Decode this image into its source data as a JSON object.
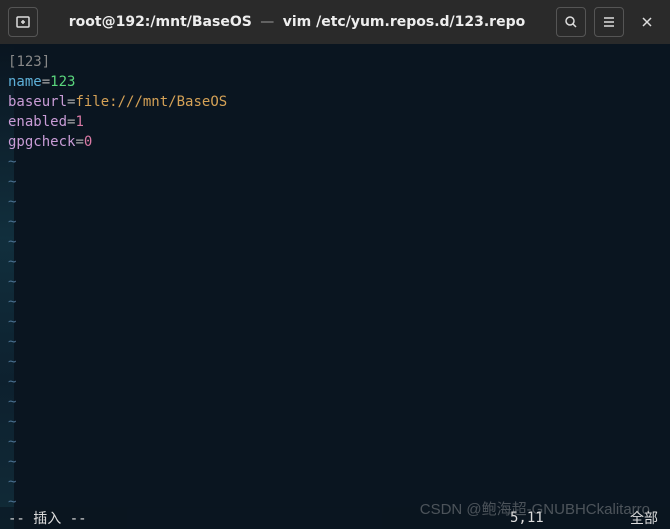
{
  "titlebar": {
    "title_left": "root@192:/mnt/BaseOS",
    "title_right": "vim /etc/yum.repos.d/123.repo"
  },
  "content": {
    "section": "123",
    "line1_key": "name",
    "line1_val": "123",
    "line2_key": "baseurl",
    "line2_val": "file:///mnt/BaseOS",
    "line3_key": "enabled",
    "line3_val": "1",
    "line4_key": "gpgcheck",
    "line4_val": "0",
    "tilde": "~"
  },
  "status": {
    "mode": "-- 插入 --",
    "position": "5,11",
    "scroll": "全部"
  },
  "watermark": "CSDN @鲍海超-GNUBHCkalitarro"
}
